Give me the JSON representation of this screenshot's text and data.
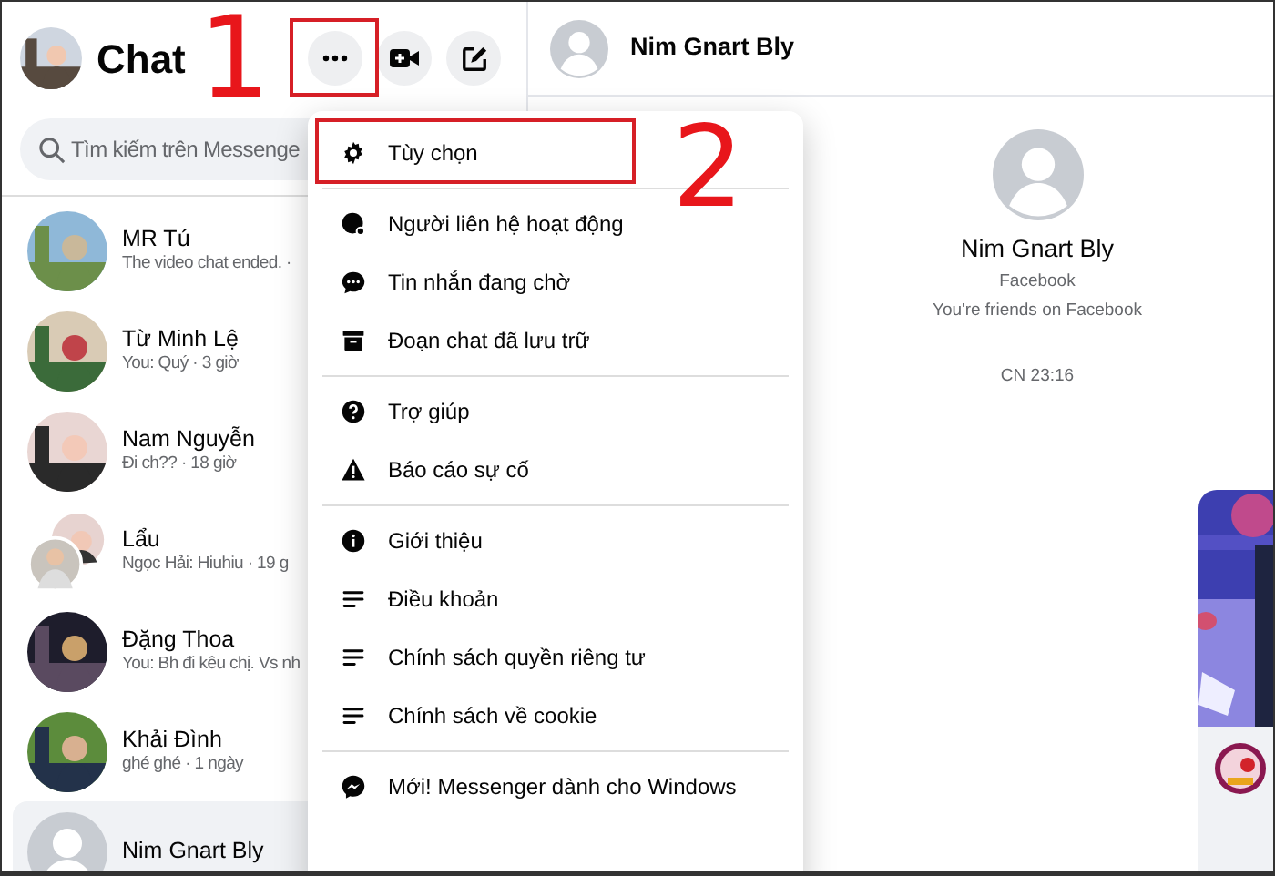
{
  "sidebar": {
    "title": "Chat",
    "search": {
      "placeholder": "Tìm kiếm trên Messenge"
    },
    "chats": [
      {
        "name": "MR Tú",
        "preview": "The video chat ended. ·",
        "selected": false
      },
      {
        "name": "Từ Minh Lệ",
        "preview": "You: Quý · 3 giờ",
        "selected": false
      },
      {
        "name": "Nam Nguyễn",
        "preview": "Đi ch?? · 18 giờ",
        "selected": false
      },
      {
        "name": "Lẩu",
        "preview": "Ngọc Hải: Hiuhiu · 19 g",
        "kind": "group",
        "selected": false
      },
      {
        "name": "Đặng Thoa",
        "preview": "You: Bh đi kêu chị. Vs nh",
        "selected": false
      },
      {
        "name": "Khải Đình",
        "preview": "ghé ghé · 1 ngày",
        "selected": false
      },
      {
        "name": "Nim Gnart Bly",
        "kind": "default",
        "selected": true
      }
    ]
  },
  "menu": {
    "sections": [
      [
        {
          "label": "Tùy chọn"
        }
      ],
      [
        {
          "label": "Người liên hệ hoạt động"
        },
        {
          "label": "Tin nhắn đang chờ"
        },
        {
          "label": "Đoạn chat đã lưu trữ"
        }
      ],
      [
        {
          "label": "Trợ giúp"
        },
        {
          "label": "Báo cáo sự cố"
        }
      ],
      [
        {
          "label": "Giới thiệu"
        },
        {
          "label": "Điều khoản"
        },
        {
          "label": "Chính sách quyền riêng tư"
        },
        {
          "label": "Chính sách về cookie"
        }
      ],
      [
        {
          "label": "Mới! Messenger dành cho Windows"
        }
      ]
    ]
  },
  "conversation": {
    "header_name": "Nim Gnart Bly",
    "profile": {
      "name": "Nim Gnart Bly",
      "source": "Facebook",
      "relation": "You're friends on Facebook"
    },
    "timestamp": "CN 23:16"
  },
  "annotations": [
    {
      "label": "1"
    },
    {
      "label": "2"
    }
  ]
}
